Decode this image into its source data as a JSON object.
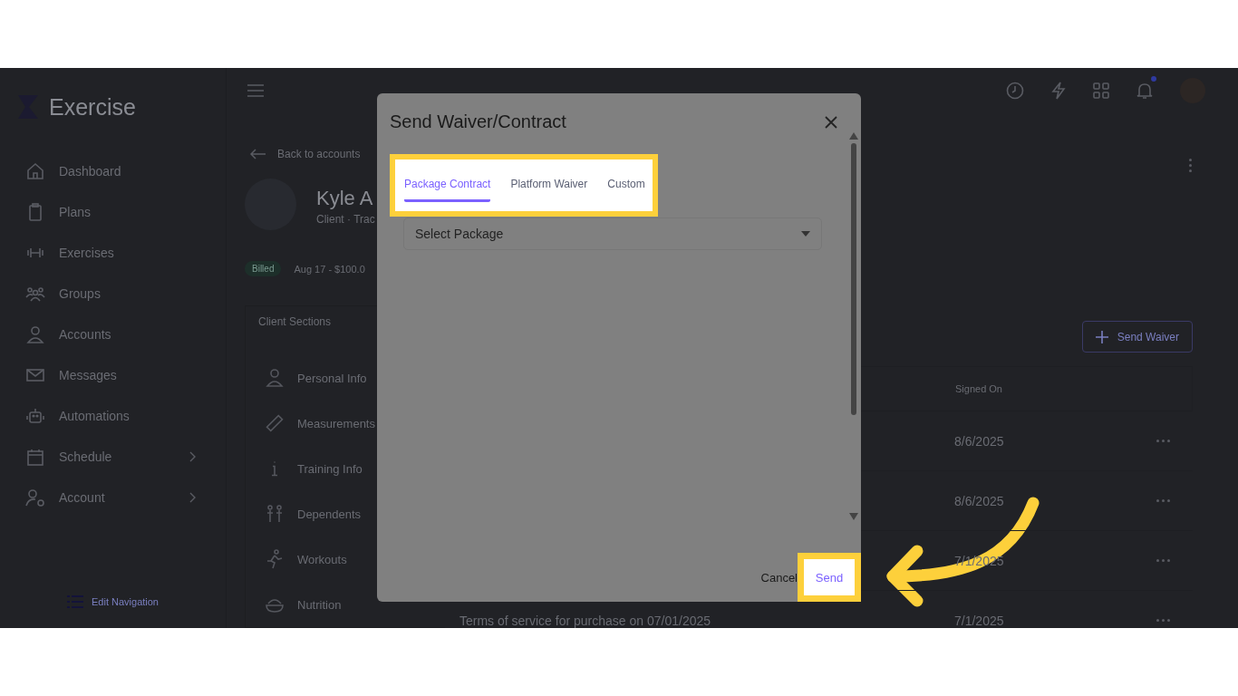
{
  "sidebar": {
    "logo_text": "Exercise",
    "items": [
      {
        "label": "Dashboard",
        "expandable": false
      },
      {
        "label": "Plans",
        "expandable": false
      },
      {
        "label": "Exercises",
        "expandable": false
      },
      {
        "label": "Groups",
        "expandable": false
      },
      {
        "label": "Accounts",
        "expandable": false
      },
      {
        "label": "Messages",
        "expandable": false
      },
      {
        "label": "Automations",
        "expandable": false
      },
      {
        "label": "Schedule",
        "expandable": true
      },
      {
        "label": "Account",
        "expandable": true
      }
    ],
    "edit_navigation": "Edit Navigation"
  },
  "header": {
    "notification_unread": true
  },
  "profile": {
    "back_link": "Back to accounts",
    "name": "Kyle A",
    "subtitle": "Client · Trac",
    "status_badge": "Billed",
    "billing": "Aug 17 - $100.0"
  },
  "client_sections": {
    "title": "Client Sections",
    "items": [
      "Personal Info",
      "Measurements",
      "Training Info",
      "Dependents",
      "Workouts",
      "Nutrition"
    ]
  },
  "waivers": {
    "send_button": "Send Waiver",
    "columns": [
      "Signed On"
    ],
    "rows": [
      {
        "signed_on": "8/6/2025"
      },
      {
        "signed_on": "8/6/2025"
      },
      {
        "signed_on": "7/1/2025"
      },
      {
        "title": "Terms of service for purchase on 07/01/2025",
        "signed_on": "7/1/2025"
      }
    ]
  },
  "dialog": {
    "title": "Send Waiver/Contract",
    "tabs": [
      {
        "label": "Package Contract",
        "selected": true
      },
      {
        "label": "Platform Waiver",
        "selected": false
      },
      {
        "label": "Custom",
        "selected": false
      }
    ],
    "select": {
      "placeholder": "Select Package"
    },
    "buttons": [
      {
        "label": "Cancel",
        "kind": "plain"
      },
      {
        "label": "Send",
        "kind": "primary"
      }
    ]
  }
}
